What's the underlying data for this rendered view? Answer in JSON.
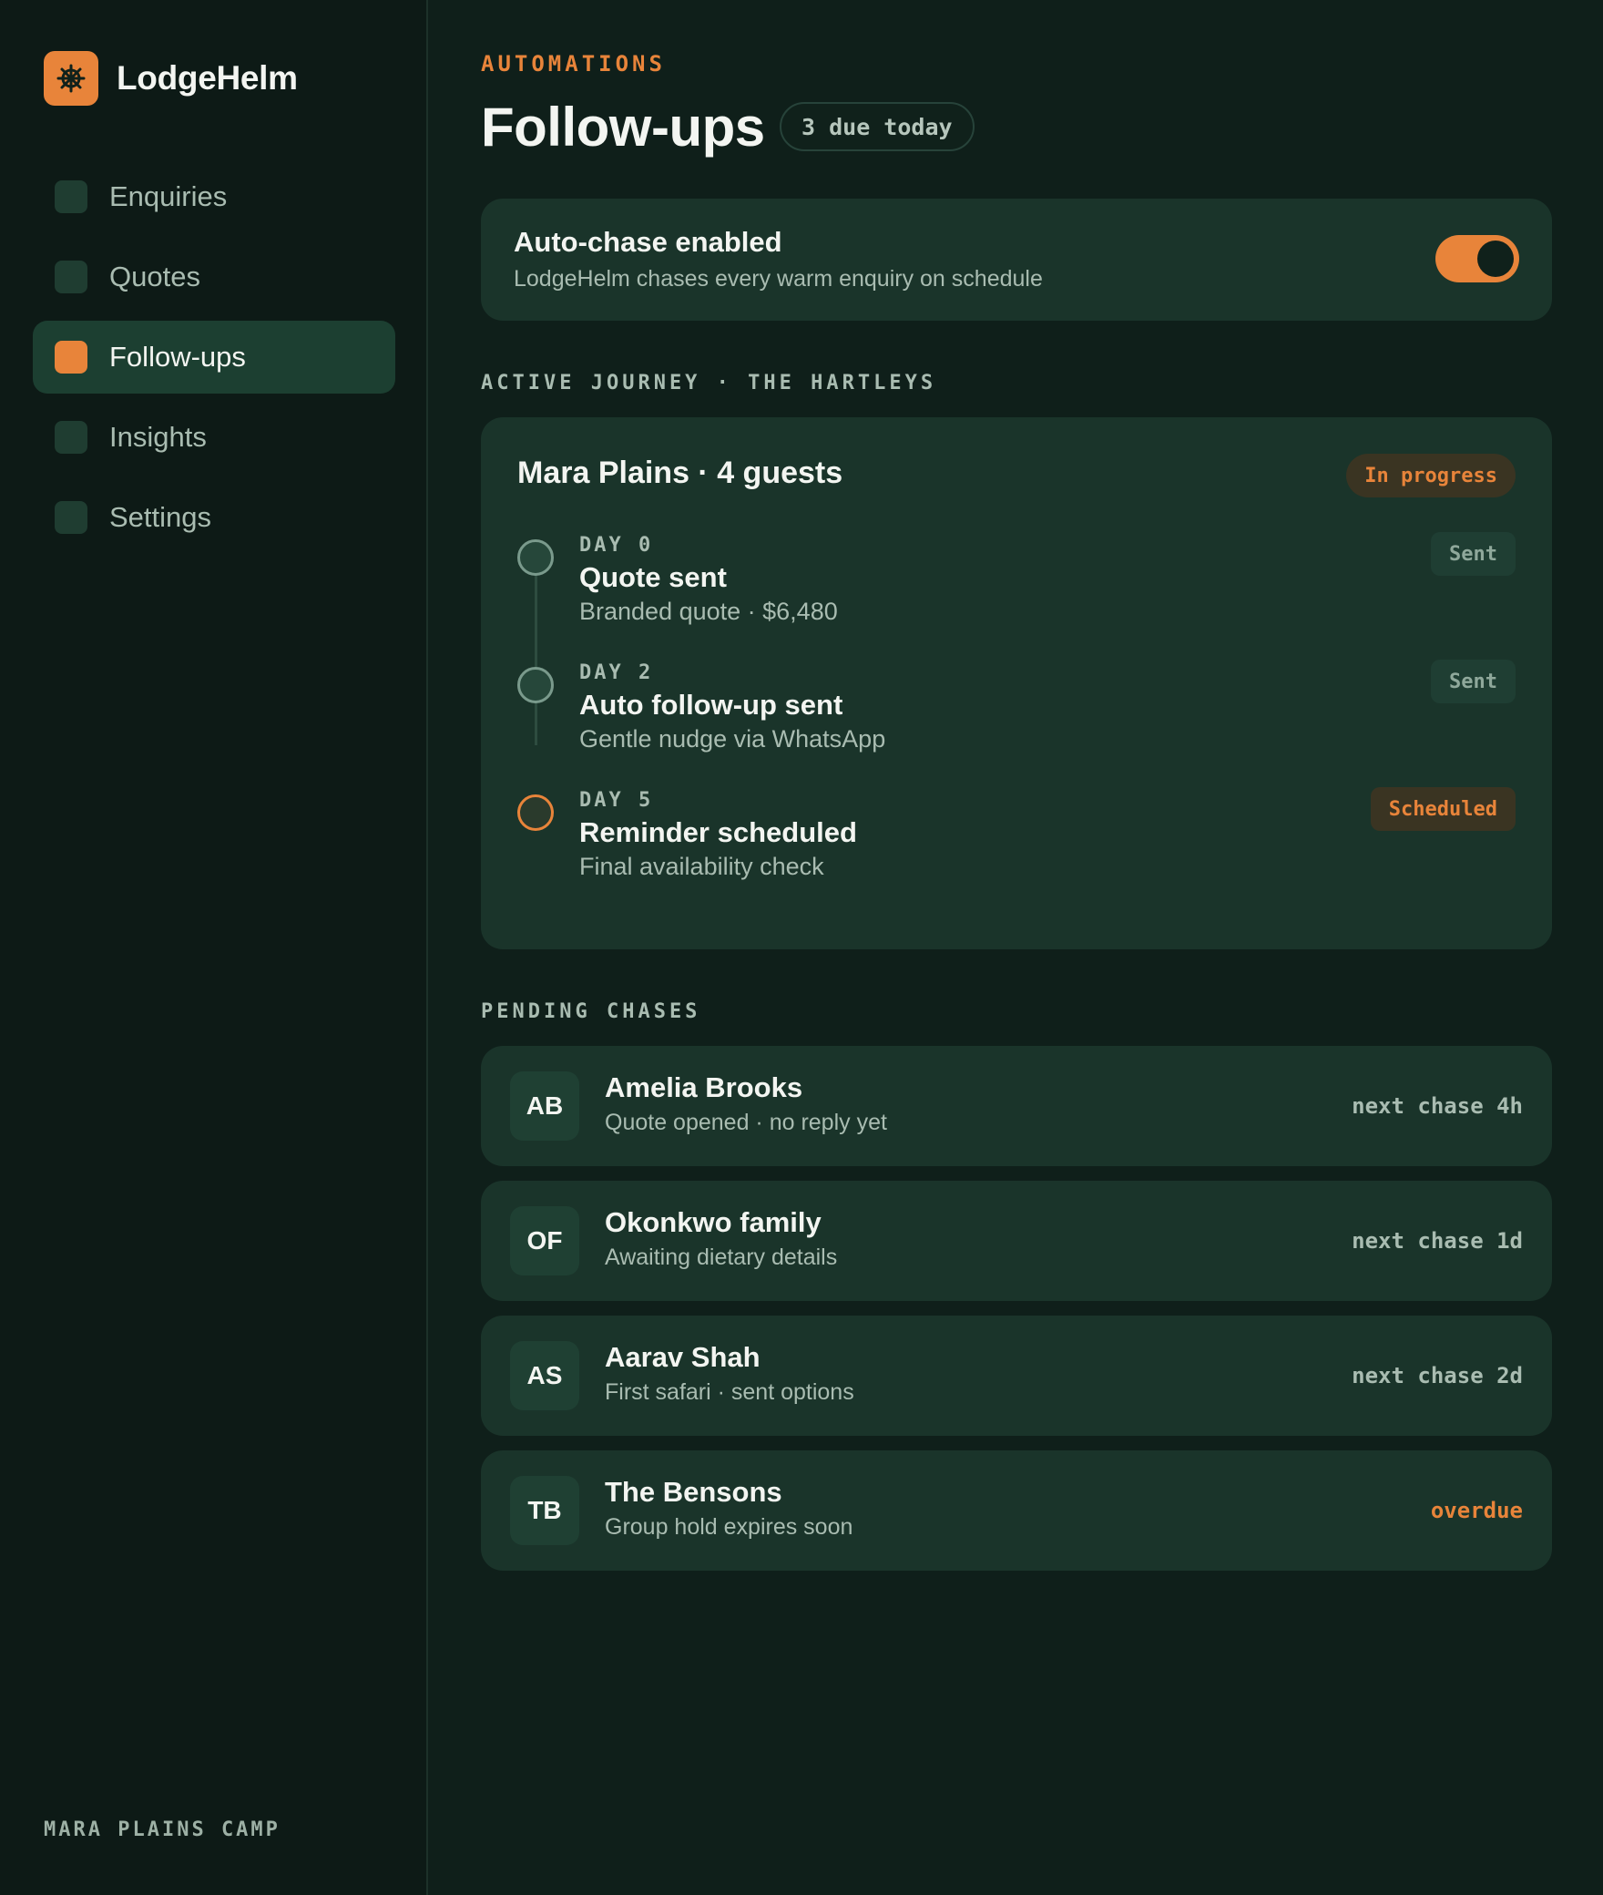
{
  "app": {
    "name": "LodgeHelm",
    "logo_icon": "ships-wheel-icon",
    "accent": "#e8843a",
    "footer": "MARA PLAINS CAMP"
  },
  "sidebar": {
    "items": [
      {
        "label": "Enquiries",
        "active": false
      },
      {
        "label": "Quotes",
        "active": false
      },
      {
        "label": "Follow-ups",
        "active": true
      },
      {
        "label": "Insights",
        "active": false
      },
      {
        "label": "Settings",
        "active": false
      }
    ]
  },
  "header": {
    "eyebrow": "AUTOMATIONS",
    "title": "Follow-ups",
    "badge": "3 due today"
  },
  "auto_chase": {
    "title": "Auto-chase enabled",
    "subtitle": "LodgeHelm chases every warm enquiry on schedule",
    "enabled": true
  },
  "journey": {
    "section_label": "ACTIVE JOURNEY · THE HARTLEYS",
    "title": "Mara Plains · 4 guests",
    "status": "In progress",
    "steps": [
      {
        "day": "DAY 0",
        "title": "Quote sent",
        "subtitle": "Branded quote · $6,480",
        "status": "Sent"
      },
      {
        "day": "DAY 2",
        "title": "Auto follow-up sent",
        "subtitle": "Gentle nudge via WhatsApp",
        "status": "Sent"
      },
      {
        "day": "DAY 5",
        "title": "Reminder scheduled",
        "subtitle": "Final availability check",
        "status": "Scheduled"
      }
    ]
  },
  "pending": {
    "section_label": "PENDING CHASES",
    "items": [
      {
        "initials": "AB",
        "name": "Amelia Brooks",
        "subtitle": "Quote opened · no reply yet",
        "meta": "next chase 4h"
      },
      {
        "initials": "OF",
        "name": "Okonkwo family",
        "subtitle": "Awaiting dietary details",
        "meta": "next chase 1d"
      },
      {
        "initials": "AS",
        "name": "Aarav Shah",
        "subtitle": "First safari · sent options",
        "meta": "next chase 2d"
      },
      {
        "initials": "TB",
        "name": "The Bensons",
        "subtitle": "Group hold expires soon",
        "meta": "overdue"
      }
    ]
  }
}
